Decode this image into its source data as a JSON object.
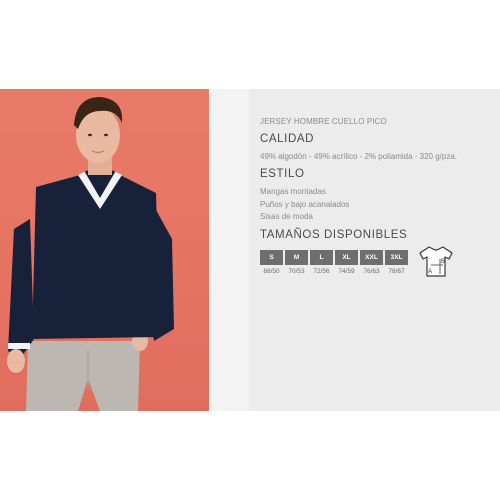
{
  "product": {
    "subtitle": "JERSEY HOMBRE CUELLO PICO",
    "quality_heading": "CALIDAD",
    "composition": "49% algodón - 49% acrílico - 2% poliamida - 320 g/pza.",
    "style_heading": "ESTILO",
    "features": [
      "Mangas montadas",
      "Puños y bajo acanalados",
      "Sisas de moda"
    ],
    "sizes_heading": "TAMAÑOS DISPONIBLES",
    "sizes": [
      {
        "label": "S",
        "measure": "68/50"
      },
      {
        "label": "M",
        "measure": "70/53"
      },
      {
        "label": "L",
        "measure": "72/56"
      },
      {
        "label": "XL",
        "measure": "74/59"
      },
      {
        "label": "XXL",
        "measure": "76/63"
      },
      {
        "label": "3XL",
        "measure": "78/67"
      }
    ]
  },
  "icons": {
    "measure_chart": "tshirt-measure-icon",
    "measure_a_label": "A",
    "measure_b_label": "B"
  },
  "colors": {
    "photo_background": "#e97a68",
    "info_background": "#ececec",
    "size_tag": "#6e6e6e"
  }
}
